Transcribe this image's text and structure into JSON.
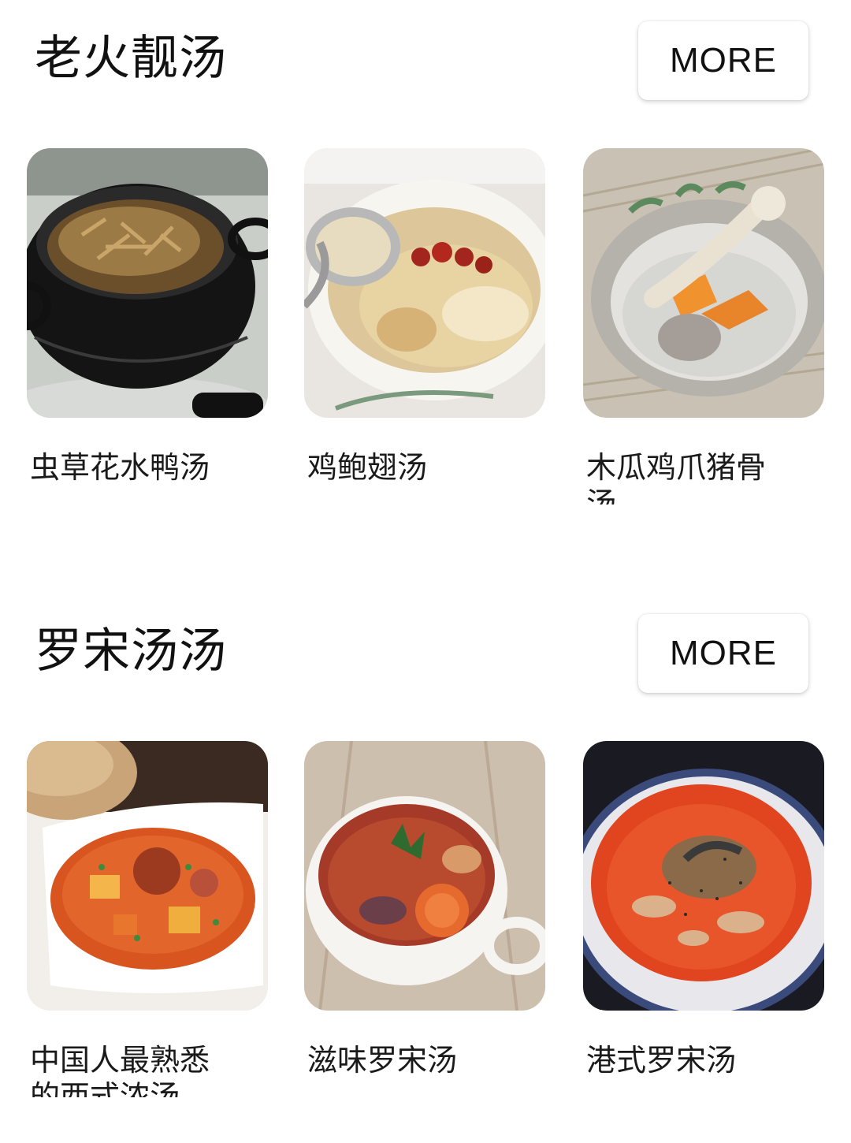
{
  "sections": [
    {
      "title": "老火靓汤",
      "more_label": "MORE",
      "items": [
        {
          "label": "虫草花水鸭汤",
          "image": "black-clay-pot-soup"
        },
        {
          "label": "鸡鲍翅汤",
          "image": "white-pot-chicken-soup"
        },
        {
          "label": "木瓜鸡爪猪骨汤",
          "image": "papaya-chicken-bone-soup"
        }
      ]
    },
    {
      "title": "罗宋汤汤",
      "more_label": "MORE",
      "items": [
        {
          "label": "中国人最熟悉的西式浓汤",
          "image": "borscht-bowl-with-bread"
        },
        {
          "label": "滋味罗宋汤",
          "image": "borscht-cup"
        },
        {
          "label": "港式罗宋汤",
          "image": "hk-borscht-plate"
        }
      ]
    }
  ],
  "colors": {
    "background": "#ffffff",
    "text": "#111111",
    "button_bg": "#ffffff"
  }
}
